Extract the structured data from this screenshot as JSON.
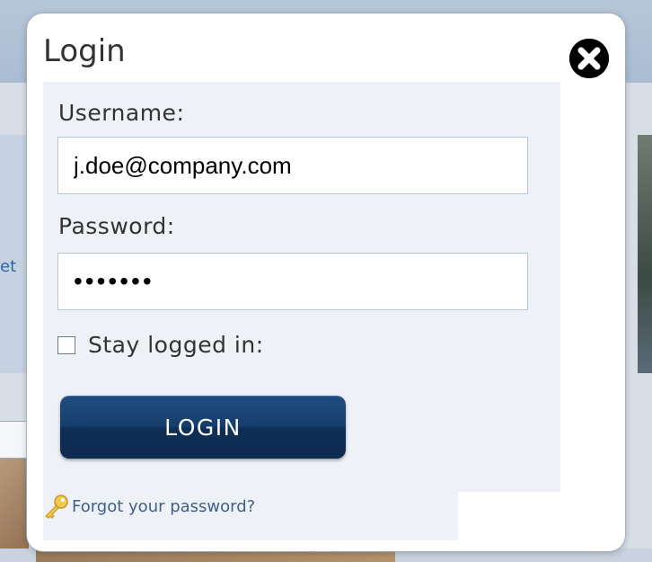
{
  "modal": {
    "title": "Login",
    "close_icon": "close-icon"
  },
  "form": {
    "username_label": "Username:",
    "username_value": "j.doe@company.com",
    "password_label": "Password:",
    "password_value": "•••••••",
    "stay_logged_in_label": "Stay logged in:",
    "stay_logged_in_checked": false,
    "login_button_label": "LOGIN",
    "forgot_icon": "key-icon",
    "forgot_link": "Forgot your password?"
  },
  "background": {
    "left_edge_text": "et"
  },
  "colors": {
    "button": "#163e6c",
    "link": "#3f5f8a",
    "panel": "#eef1f6"
  }
}
